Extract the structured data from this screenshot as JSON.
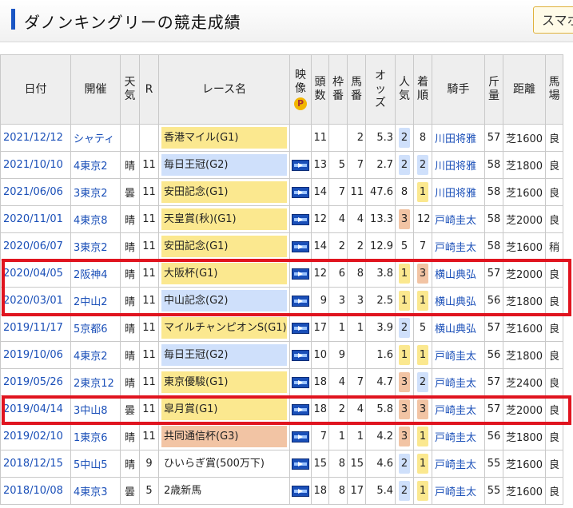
{
  "header": {
    "title": "ダノンキングリーの競走成績",
    "sma_button": "スマホ"
  },
  "table": {
    "columns": [
      "日付",
      "開催",
      "天気",
      "R",
      "レース名",
      "映像",
      "頭数",
      "枠番",
      "馬番",
      "オッズ",
      "人気",
      "着順",
      "騎手",
      "斤量",
      "距離",
      "馬場"
    ],
    "video_p": "P",
    "rows": [
      {
        "date": "2021/12/12",
        "venue": "シャティ",
        "weather": "",
        "r": "",
        "race": "香港マイル(G1)",
        "race_color": "#fbe88f",
        "video": false,
        "heads": "11",
        "waku": "",
        "umaban": "2",
        "odds": "5.3",
        "ninki": "2",
        "ninki_color": "#cfe0fb",
        "chakujun": "8",
        "chaku_color": "",
        "jockey": "川田将雅",
        "kinryo": "57",
        "distance": "芝1600",
        "baba": "良"
      },
      {
        "date": "2021/10/10",
        "venue": "4東京2",
        "weather": "晴",
        "r": "11",
        "race": "毎日王冠(G2)",
        "race_color": "#cfe0fb",
        "video": true,
        "heads": "13",
        "waku": "5",
        "umaban": "7",
        "odds": "2.7",
        "ninki": "2",
        "ninki_color": "#cfe0fb",
        "chakujun": "2",
        "chaku_color": "#cfe0fb",
        "jockey": "川田将雅",
        "kinryo": "58",
        "distance": "芝1800",
        "baba": "良"
      },
      {
        "date": "2021/06/06",
        "venue": "3東京2",
        "weather": "曇",
        "r": "11",
        "race": "安田記念(G1)",
        "race_color": "#fbe88f",
        "video": true,
        "heads": "14",
        "waku": "7",
        "umaban": "11",
        "odds": "47.6",
        "ninki": "8",
        "ninki_color": "",
        "chakujun": "1",
        "chaku_color": "#fbe88f",
        "jockey": "川田将雅",
        "kinryo": "58",
        "distance": "芝1600",
        "baba": "良"
      },
      {
        "date": "2020/11/01",
        "venue": "4東京8",
        "weather": "晴",
        "r": "11",
        "race": "天皇賞(秋)(G1)",
        "race_color": "#fbe88f",
        "video": true,
        "heads": "12",
        "waku": "4",
        "umaban": "4",
        "odds": "13.3",
        "ninki": "3",
        "ninki_color": "#f2c4a4",
        "chakujun": "12",
        "chaku_color": "",
        "jockey": "戸崎圭太",
        "kinryo": "58",
        "distance": "芝2000",
        "baba": "良"
      },
      {
        "date": "2020/06/07",
        "venue": "3東京2",
        "weather": "晴",
        "r": "11",
        "race": "安田記念(G1)",
        "race_color": "#fbe88f",
        "video": true,
        "heads": "14",
        "waku": "2",
        "umaban": "2",
        "odds": "12.9",
        "ninki": "5",
        "ninki_color": "",
        "chakujun": "7",
        "chaku_color": "",
        "jockey": "戸崎圭太",
        "kinryo": "58",
        "distance": "芝1600",
        "baba": "稍"
      },
      {
        "date": "2020/04/05",
        "venue": "2阪神4",
        "weather": "晴",
        "r": "11",
        "race": "大阪杯(G1)",
        "race_color": "#fbe88f",
        "video": true,
        "heads": "12",
        "waku": "6",
        "umaban": "8",
        "odds": "3.8",
        "ninki": "1",
        "ninki_color": "#fbe88f",
        "chakujun": "3",
        "chaku_color": "#f2c4a4",
        "jockey": "横山典弘",
        "kinryo": "57",
        "distance": "芝2000",
        "baba": "良"
      },
      {
        "date": "2020/03/01",
        "venue": "2中山2",
        "weather": "晴",
        "r": "11",
        "race": "中山記念(G2)",
        "race_color": "#cfe0fb",
        "video": true,
        "heads": "9",
        "waku": "3",
        "umaban": "3",
        "odds": "2.5",
        "ninki": "1",
        "ninki_color": "#fbe88f",
        "chakujun": "1",
        "chaku_color": "#fbe88f",
        "jockey": "横山典弘",
        "kinryo": "56",
        "distance": "芝1800",
        "baba": "良"
      },
      {
        "date": "2019/11/17",
        "venue": "5京都6",
        "weather": "晴",
        "r": "11",
        "race": "マイルチャンピオンS(G1)",
        "race_color": "#fbe88f",
        "video": true,
        "heads": "17",
        "waku": "1",
        "umaban": "1",
        "odds": "3.9",
        "ninki": "2",
        "ninki_color": "#cfe0fb",
        "chakujun": "5",
        "chaku_color": "",
        "jockey": "横山典弘",
        "kinryo": "57",
        "distance": "芝1600",
        "baba": "良"
      },
      {
        "date": "2019/10/06",
        "venue": "4東京2",
        "weather": "晴",
        "r": "11",
        "race": "毎日王冠(G2)",
        "race_color": "#cfe0fb",
        "video": true,
        "heads": "10",
        "waku": "9",
        "umaban": "",
        "odds": "1.6",
        "ninki": "1",
        "ninki_color": "#fbe88f",
        "chakujun": "1",
        "chaku_color": "#fbe88f",
        "jockey": "戸崎圭太",
        "kinryo": "56",
        "distance": "芝1800",
        "baba": "良"
      },
      {
        "date": "2019/05/26",
        "venue": "2東京12",
        "weather": "晴",
        "r": "11",
        "race": "東京優駿(G1)",
        "race_color": "#fbe88f",
        "video": true,
        "heads": "18",
        "waku": "4",
        "umaban": "7",
        "odds": "4.7",
        "ninki": "3",
        "ninki_color": "#f2c4a4",
        "chakujun": "2",
        "chaku_color": "#cfe0fb",
        "jockey": "戸崎圭太",
        "kinryo": "57",
        "distance": "芝2400",
        "baba": "良"
      },
      {
        "date": "2019/04/14",
        "venue": "3中山8",
        "weather": "曇",
        "r": "11",
        "race": "皐月賞(G1)",
        "race_color": "#fbe88f",
        "video": true,
        "heads": "18",
        "waku": "2",
        "umaban": "4",
        "odds": "5.8",
        "ninki": "3",
        "ninki_color": "#f2c4a4",
        "chakujun": "3",
        "chaku_color": "#f2c4a4",
        "jockey": "戸崎圭太",
        "kinryo": "57",
        "distance": "芝2000",
        "baba": "良"
      },
      {
        "date": "2019/02/10",
        "venue": "1東京6",
        "weather": "晴",
        "r": "11",
        "race": "共同通信杯(G3)",
        "race_color": "#f2c4a4",
        "video": true,
        "heads": "7",
        "waku": "1",
        "umaban": "1",
        "odds": "4.2",
        "ninki": "3",
        "ninki_color": "#f2c4a4",
        "chakujun": "1",
        "chaku_color": "#fbe88f",
        "jockey": "戸崎圭太",
        "kinryo": "56",
        "distance": "芝1800",
        "baba": "良"
      },
      {
        "date": "2018/12/15",
        "venue": "5中山5",
        "weather": "晴",
        "r": "9",
        "race": "ひいらぎ賞(500万下)",
        "race_color": "",
        "video": true,
        "heads": "15",
        "waku": "8",
        "umaban": "15",
        "odds": "4.6",
        "ninki": "2",
        "ninki_color": "#cfe0fb",
        "chakujun": "1",
        "chaku_color": "#fbe88f",
        "jockey": "戸崎圭太",
        "kinryo": "55",
        "distance": "芝1600",
        "baba": "良"
      },
      {
        "date": "2018/10/08",
        "venue": "4東京3",
        "weather": "曇",
        "r": "5",
        "race": "2歳新馬",
        "race_color": "",
        "video": true,
        "heads": "18",
        "waku": "8",
        "umaban": "17",
        "odds": "5.4",
        "ninki": "2",
        "ninki_color": "#cfe0fb",
        "chakujun": "1",
        "chaku_color": "#fbe88f",
        "jockey": "戸崎圭太",
        "kinryo": "55",
        "distance": "芝1600",
        "baba": "良"
      }
    ]
  }
}
